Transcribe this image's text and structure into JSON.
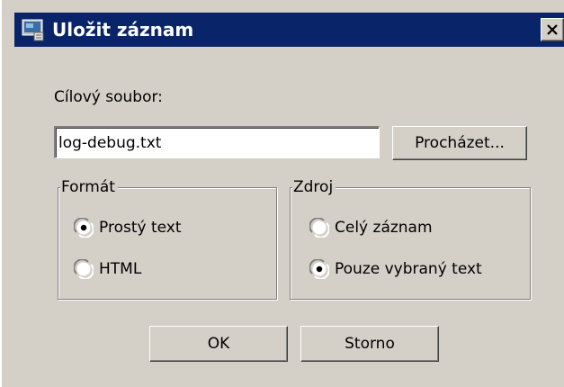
{
  "dialog": {
    "title": "Uložit záznam",
    "close_glyph": "×"
  },
  "target_file": {
    "label": "Cílový soubor:",
    "value": "log-debug.txt",
    "browse_label": "Procházet..."
  },
  "format_group": {
    "legend": "Formát",
    "options": [
      {
        "label": "Prostý text",
        "checked": true
      },
      {
        "label": "HTML",
        "checked": false
      }
    ]
  },
  "source_group": {
    "legend": "Zdroj",
    "options": [
      {
        "label": "Celý záznam",
        "checked": false
      },
      {
        "label": "Pouze vybraný text",
        "checked": true
      }
    ]
  },
  "buttons": {
    "ok_label": "OK",
    "cancel_label": "Storno"
  },
  "colors": {
    "titlebar": "#0a246a",
    "face": "#d4d0c8"
  }
}
